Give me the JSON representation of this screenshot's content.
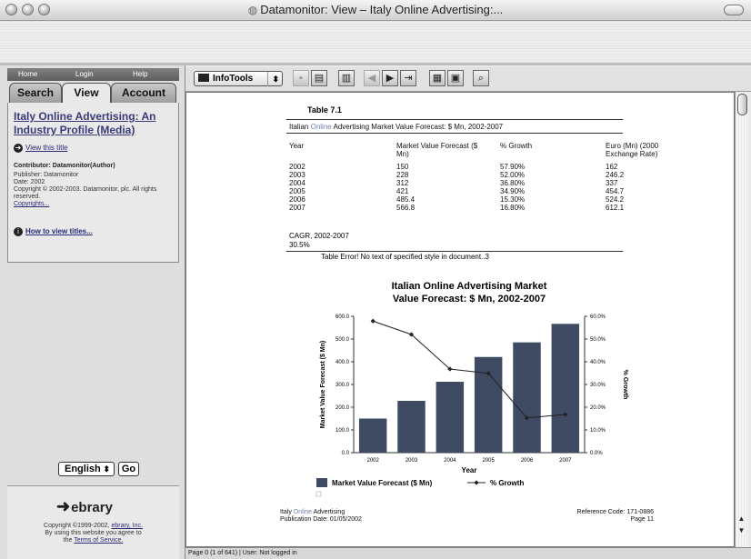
{
  "window": {
    "title": "Datamonitor: View – Italy Online Advertising:..."
  },
  "sidebar": {
    "nav": [
      "Home",
      "Login",
      "Help"
    ],
    "tabs": [
      "Search",
      "View",
      "Account"
    ],
    "book_title": "Italy Online Advertising: An Industry Profile (Media)",
    "view_link": "View this title",
    "contributor": "Contributor: Datamonitor(Author)",
    "publisher": "Publisher: Datamonitor",
    "date": "Date: 2002",
    "copyright": "Copyright © 2002-2003. Datamonitor, plc. All rights reserved.",
    "copyrights_link": "Copyrights...",
    "howto_link": "How to view titles...",
    "language": "English",
    "go": "Go",
    "logo": "ebrary",
    "footer_line1": "Copyright ©1999-2002,",
    "footer_link1": "ebrary, Inc.",
    "footer_line2": "By using this website you agree to",
    "footer_line3": "the",
    "footer_link2": "Terms of Service."
  },
  "toolbar": {
    "infotools": "InfoTools"
  },
  "document": {
    "table_title": "Table 7.1",
    "caption_pre": "Italian",
    "caption_online": "Online",
    "caption_post": "Advertising Market Value Forecast: $ Mn, 2002-2007",
    "headers": [
      "Year",
      "Market Value Forecast ($ Mn)",
      "% Growth",
      "Euro (Mn) (2000 Exchange Rate)"
    ],
    "rows": [
      [
        "2002",
        "150",
        "57.90%",
        "162"
      ],
      [
        "2003",
        "228",
        "52.00%",
        "246.2"
      ],
      [
        "2004",
        "312",
        "36.80%",
        "337"
      ],
      [
        "2005",
        "421",
        "34.90%",
        "454.7"
      ],
      [
        "2006",
        "485.4",
        "15.30%",
        "524.2"
      ],
      [
        "2007",
        "566.8",
        "16.80%",
        "612.1"
      ]
    ],
    "cagr_label": "CAGR, 2002-2007",
    "cagr_value": "30.5%",
    "error_text": "Table Error! No text of specified style in document..3",
    "footer_left1_a": "Italy",
    "footer_left1_b": "Online",
    "footer_left1_c": "Advertising",
    "footer_left2": "Publication Date: 01/05/2002",
    "footer_right1": "Reference Code: 171-0886",
    "footer_right2": "Page 11"
  },
  "status": "Page 0 (1 of 641) | User: Not logged in",
  "chart_data": {
    "type": "bar",
    "title": "Italian Online Advertising Market Value Forecast: $ Mn, 2002-2007",
    "title_line1": "Italian Online Advertising Market",
    "title_line2": "Value Forecast: $ Mn, 2002-2007",
    "categories": [
      "2002",
      "2003",
      "2004",
      "2005",
      "2006",
      "2007"
    ],
    "xlabel": "Year",
    "ylabel": "Market Value Forecast ($ Mn)",
    "y2label": "% Growth",
    "ylim": [
      0,
      600
    ],
    "y2lim": [
      0,
      60
    ],
    "yticks": [
      "0.0",
      "100.0",
      "200.0",
      "300.0",
      "400.0",
      "500.0",
      "600.0"
    ],
    "y2ticks": [
      "0.0%",
      "10.0%",
      "20.0%",
      "30.0%",
      "40.0%",
      "50.0%",
      "60.0%"
    ],
    "series": [
      {
        "name": "Market Value Forecast ($ Mn)",
        "kind": "bar",
        "values": [
          150,
          228,
          312,
          421,
          485.4,
          566.8
        ],
        "color": "#3f4a63"
      },
      {
        "name": "% Growth",
        "kind": "line",
        "axis": "right",
        "values": [
          57.9,
          52.0,
          36.8,
          34.9,
          15.3,
          16.8
        ],
        "color": "#222222"
      }
    ],
    "legend": [
      "Market Value Forecast ($ Mn)",
      "% Growth"
    ],
    "legend_position": "bottom"
  }
}
